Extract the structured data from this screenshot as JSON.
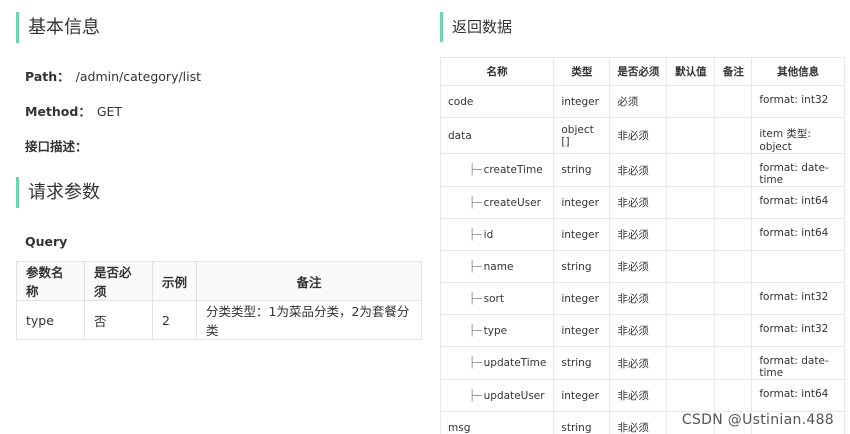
{
  "left": {
    "basic_title": "基本信息",
    "path_label": "Path：",
    "path_value": "/admin/category/list",
    "method_label": "Method：",
    "method_value": "GET",
    "desc_label": "接口描述：",
    "params_title": "请求参数",
    "query_title": "Query",
    "query_headers": [
      "参数名称",
      "是否必须",
      "示例",
      "备注"
    ],
    "query_rows": [
      [
        "type",
        "否",
        "2",
        "分类类型：1为菜品分类，2为套餐分类"
      ]
    ]
  },
  "right": {
    "title": "返回数据",
    "headers": [
      "名称",
      "类型",
      "是否必须",
      "默认值",
      "备注",
      "其他信息"
    ],
    "tree_prefix": "├─",
    "rows": [
      {
        "name": "code",
        "child": false,
        "type": "integer",
        "required": "必须",
        "default": "",
        "note": "",
        "other": "format: int32"
      },
      {
        "name": "data",
        "child": false,
        "type": "object []",
        "required": "非必须",
        "default": "",
        "note": "",
        "other": "item 类型: object"
      },
      {
        "name": "createTime",
        "child": true,
        "type": "string",
        "required": "非必须",
        "default": "",
        "note": "",
        "other": "format: date-time"
      },
      {
        "name": "createUser",
        "child": true,
        "type": "integer",
        "required": "非必须",
        "default": "",
        "note": "",
        "other": "format: int64"
      },
      {
        "name": "id",
        "child": true,
        "type": "integer",
        "required": "非必须",
        "default": "",
        "note": "",
        "other": "format: int64"
      },
      {
        "name": "name",
        "child": true,
        "type": "string",
        "required": "非必须",
        "default": "",
        "note": "",
        "other": ""
      },
      {
        "name": "sort",
        "child": true,
        "type": "integer",
        "required": "非必须",
        "default": "",
        "note": "",
        "other": "format: int32"
      },
      {
        "name": "type",
        "child": true,
        "type": "integer",
        "required": "非必须",
        "default": "",
        "note": "",
        "other": "format: int32"
      },
      {
        "name": "updateTime",
        "child": true,
        "type": "string",
        "required": "非必须",
        "default": "",
        "note": "",
        "other": "format: date-time"
      },
      {
        "name": "updateUser",
        "child": true,
        "type": "integer",
        "required": "非必须",
        "default": "",
        "note": "",
        "other": "format: int64"
      },
      {
        "name": "msg",
        "child": false,
        "type": "string",
        "required": "非必须",
        "default": "",
        "note": "",
        "other": ""
      }
    ]
  },
  "watermark": "CSDN @Ustinian.488",
  "colors": {
    "accent": "#6bd6a8",
    "border": "#e3e3e3"
  }
}
